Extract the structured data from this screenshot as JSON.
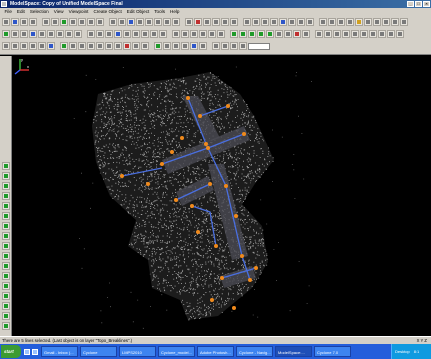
{
  "window": {
    "title": "ModelSpace: Copy of Unified ModelSpace Final",
    "controls": [
      "_",
      "□",
      "×"
    ]
  },
  "menu": [
    "File",
    "Edit",
    "Selection",
    "View",
    "Viewpoint",
    "Create Object",
    "Edit Object",
    "Tools",
    "Help"
  ],
  "status": {
    "message": "There are 5 lines selected. (Last object is on layer \"Topo_Breaklines\".)",
    "coords": "X Y Z"
  },
  "taskbar": {
    "start": "start",
    "items": [
      "Gmail - Inbox (...",
      "Cyclone",
      "LMPS2010",
      "Cyclone_model...",
      "Adobe Photosh...",
      "Cyclone - Navig...",
      "ModelSpace:...",
      "Cyclone 7.0"
    ],
    "tray_desktop": "Desktop",
    "tray_time": "8:1"
  },
  "viewport": {
    "axis_labels": [
      "x",
      "y",
      "z"
    ],
    "colors": {
      "background": "#000000",
      "points": "#d8d8d8",
      "breakline": "#4a6fe0",
      "marker": "#f08a1c"
    }
  }
}
